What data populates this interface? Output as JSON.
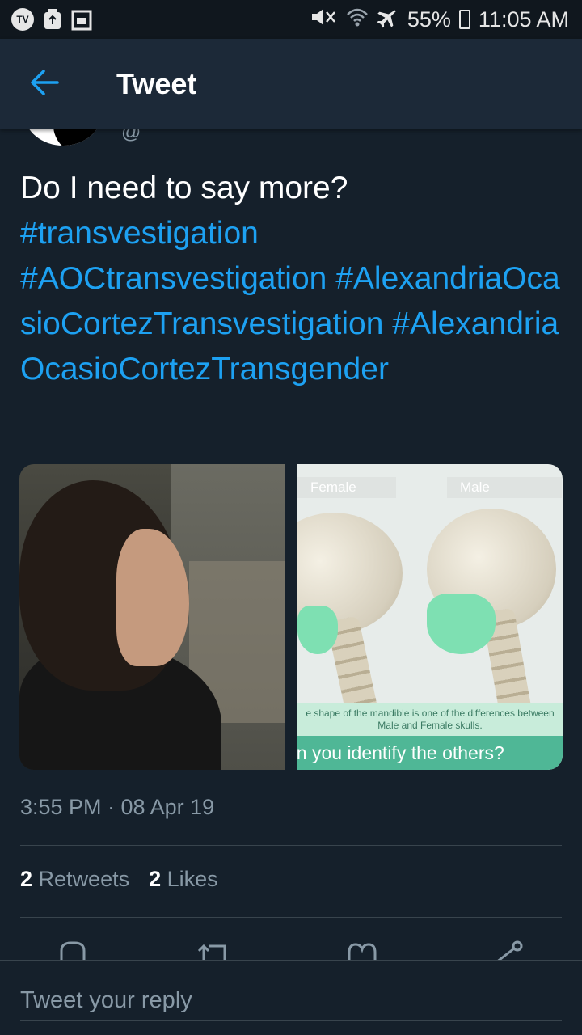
{
  "status_bar": {
    "battery": "55%",
    "time": "11:05 AM",
    "tv_badge": "TV"
  },
  "header": {
    "title": "Tweet",
    "back_icon": "arrow-left-icon"
  },
  "tweet": {
    "text_plain": "Do I need to say more?",
    "hashtags": [
      "#transvestigation",
      "#AOCtransvestigation",
      "#AlexandriaOcasioCortezTransvestigation",
      "#AlexandriaOcasioCortezTransgender"
    ],
    "timestamp": "3:55 PM · 08 Apr 19",
    "retweets_count": "2",
    "retweets_label": "Retweets",
    "likes_count": "2",
    "likes_label": "Likes"
  },
  "media": {
    "right_image": {
      "label_female": "Female",
      "label_male": "Male",
      "caption": "e shape of the mandible is one of the differences between Male and Female skulls.",
      "question": "an you identify the others?"
    }
  },
  "actions": [
    "reply-icon",
    "retweet-icon",
    "like-icon",
    "share-icon"
  ],
  "reply": {
    "placeholder": "Tweet your reply"
  },
  "colors": {
    "background": "#15202b",
    "header": "#1c2938",
    "accent": "#1da1f2",
    "secondary_text": "#8899a6"
  }
}
